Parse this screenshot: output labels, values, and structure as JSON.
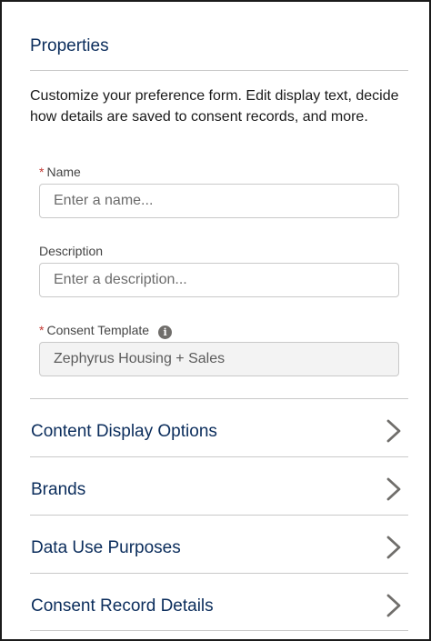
{
  "panel": {
    "title": "Properties",
    "description": "Customize your preference form. Edit display text, decide how details are saved to consent records, and more."
  },
  "fields": {
    "required_marker": "*",
    "name": {
      "label": "Name",
      "placeholder": "Enter a name...",
      "value": ""
    },
    "description": {
      "label": "Description",
      "placeholder": "Enter a description...",
      "value": ""
    },
    "consent_template": {
      "label": "Consent Template",
      "value": "Zephyrus Housing + Sales",
      "info_icon": "info-icon",
      "info_glyph": "i"
    }
  },
  "sections": [
    {
      "label": "Content Display Options",
      "icon": "chevron-right-icon"
    },
    {
      "label": "Brands",
      "icon": "chevron-right-icon"
    },
    {
      "label": "Data Use Purposes",
      "icon": "chevron-right-icon"
    },
    {
      "label": "Consent Record Details",
      "icon": "chevron-right-icon"
    }
  ],
  "colors": {
    "heading": "#0b2d5c",
    "required": "#c23934",
    "border": "#c9c9c9",
    "readonly_bg": "#f3f3f3"
  }
}
